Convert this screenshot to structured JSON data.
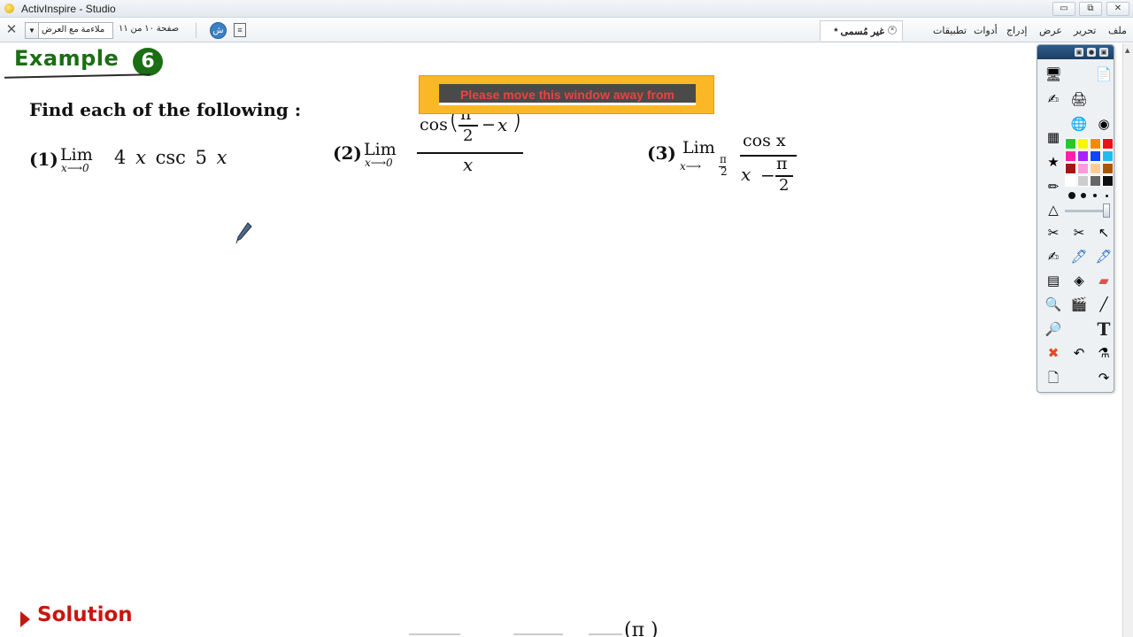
{
  "window": {
    "title": "ActivInspire - Studio",
    "minimize": "▭",
    "restore": "⧉",
    "close": "✕"
  },
  "toolbar": {
    "close_glyph": "✕",
    "fit_select": "ملاءمة مع العرض",
    "select_arrow": "▼",
    "page_indicator": "صفحة ١٠ من ١١",
    "circle_btn_glyph": "ش",
    "doc_btn_glyph": "≡",
    "document_tab": "غير مُسمى *",
    "tab_close": "×",
    "menus": [
      "ملف",
      "تحرير",
      "عرض",
      "إدراج",
      "أدوات",
      "تطبيقات"
    ]
  },
  "content": {
    "example_label": "Example",
    "example_number": "6",
    "instruction": "Find each of the following :",
    "problems": [
      {
        "number": "(1)",
        "lim": "Lim",
        "approach": "x⟶0",
        "expression_parts": [
          "4",
          "x",
          "csc",
          "5",
          "x"
        ]
      },
      {
        "number": "(2)",
        "lim": "Lim",
        "approach": "x⟶0",
        "numerator_func": "cos",
        "pi": "π",
        "two": "2",
        "minus": "−",
        "var": "x",
        "denominator": "x"
      },
      {
        "number": "(3)",
        "lim": "Lim",
        "approach_prefix": "x⟶",
        "approach_pi": "π",
        "approach_two": "2",
        "numerator": "cos x",
        "den_var": "x",
        "minus": "−",
        "pi": "π",
        "two": "2"
      }
    ],
    "solution_label": "Solution",
    "partial_bottom": "(π     )"
  },
  "notice": {
    "text": "Please move this window away from"
  },
  "toolbox": {
    "header_buttons": [
      "▣",
      "●",
      "▣"
    ],
    "colors": [
      "#22cc22",
      "#f7f700",
      "#ff8800",
      "#ee1111",
      "#ff22aa",
      "#aa22ff",
      "#1144ff",
      "#22bbee",
      "#aa1111",
      "#ff99dd",
      "#ffcc99",
      "#aa5500",
      "#ffffff",
      "#cccccc",
      "#666666",
      "#111111"
    ],
    "tools": [
      {
        "name": "teacher-icon",
        "glyph": "🖥"
      },
      {
        "name": "flipchart-icon",
        "glyph": "📄"
      },
      {
        "name": "pen-icon",
        "glyph": "✍"
      },
      {
        "name": "print-icon",
        "glyph": "🖨"
      },
      {
        "name": "globe-icon",
        "glyph": "🌐"
      },
      {
        "name": "record-icon",
        "glyph": "◉"
      },
      {
        "name": "layers-icon",
        "glyph": "▦"
      },
      {
        "name": "star-icon",
        "glyph": "★"
      },
      {
        "name": "highlighter-icon",
        "glyph": "✏"
      },
      {
        "name": "triangle-icon",
        "glyph": "△"
      },
      {
        "name": "scissors-icon",
        "glyph": "✂"
      },
      {
        "name": "tools-icon",
        "glyph": "✂"
      },
      {
        "name": "select-icon",
        "glyph": "↖"
      },
      {
        "name": "draw-icon",
        "glyph": "✍"
      },
      {
        "name": "marker-icon",
        "glyph": "🖊"
      },
      {
        "name": "pen-tool-icon",
        "glyph": "🖋"
      },
      {
        "name": "fill-icon",
        "glyph": "▤"
      },
      {
        "name": "paint-icon",
        "glyph": "◈"
      },
      {
        "name": "eraser-icon",
        "glyph": "▰"
      },
      {
        "name": "zoom-icon",
        "glyph": "🔍"
      },
      {
        "name": "clapper-icon",
        "glyph": "🎬"
      },
      {
        "name": "line-icon",
        "glyph": "╱"
      },
      {
        "name": "magnify-icon",
        "glyph": "🔎"
      },
      {
        "name": "text-icon",
        "glyph": "T"
      },
      {
        "name": "delete-icon",
        "glyph": "✖"
      },
      {
        "name": "undo-icon",
        "glyph": "↶"
      },
      {
        "name": "flask-icon",
        "glyph": "⚗"
      },
      {
        "name": "page-icon",
        "glyph": "🗋"
      },
      {
        "name": "redo-icon",
        "glyph": "↷"
      }
    ]
  }
}
